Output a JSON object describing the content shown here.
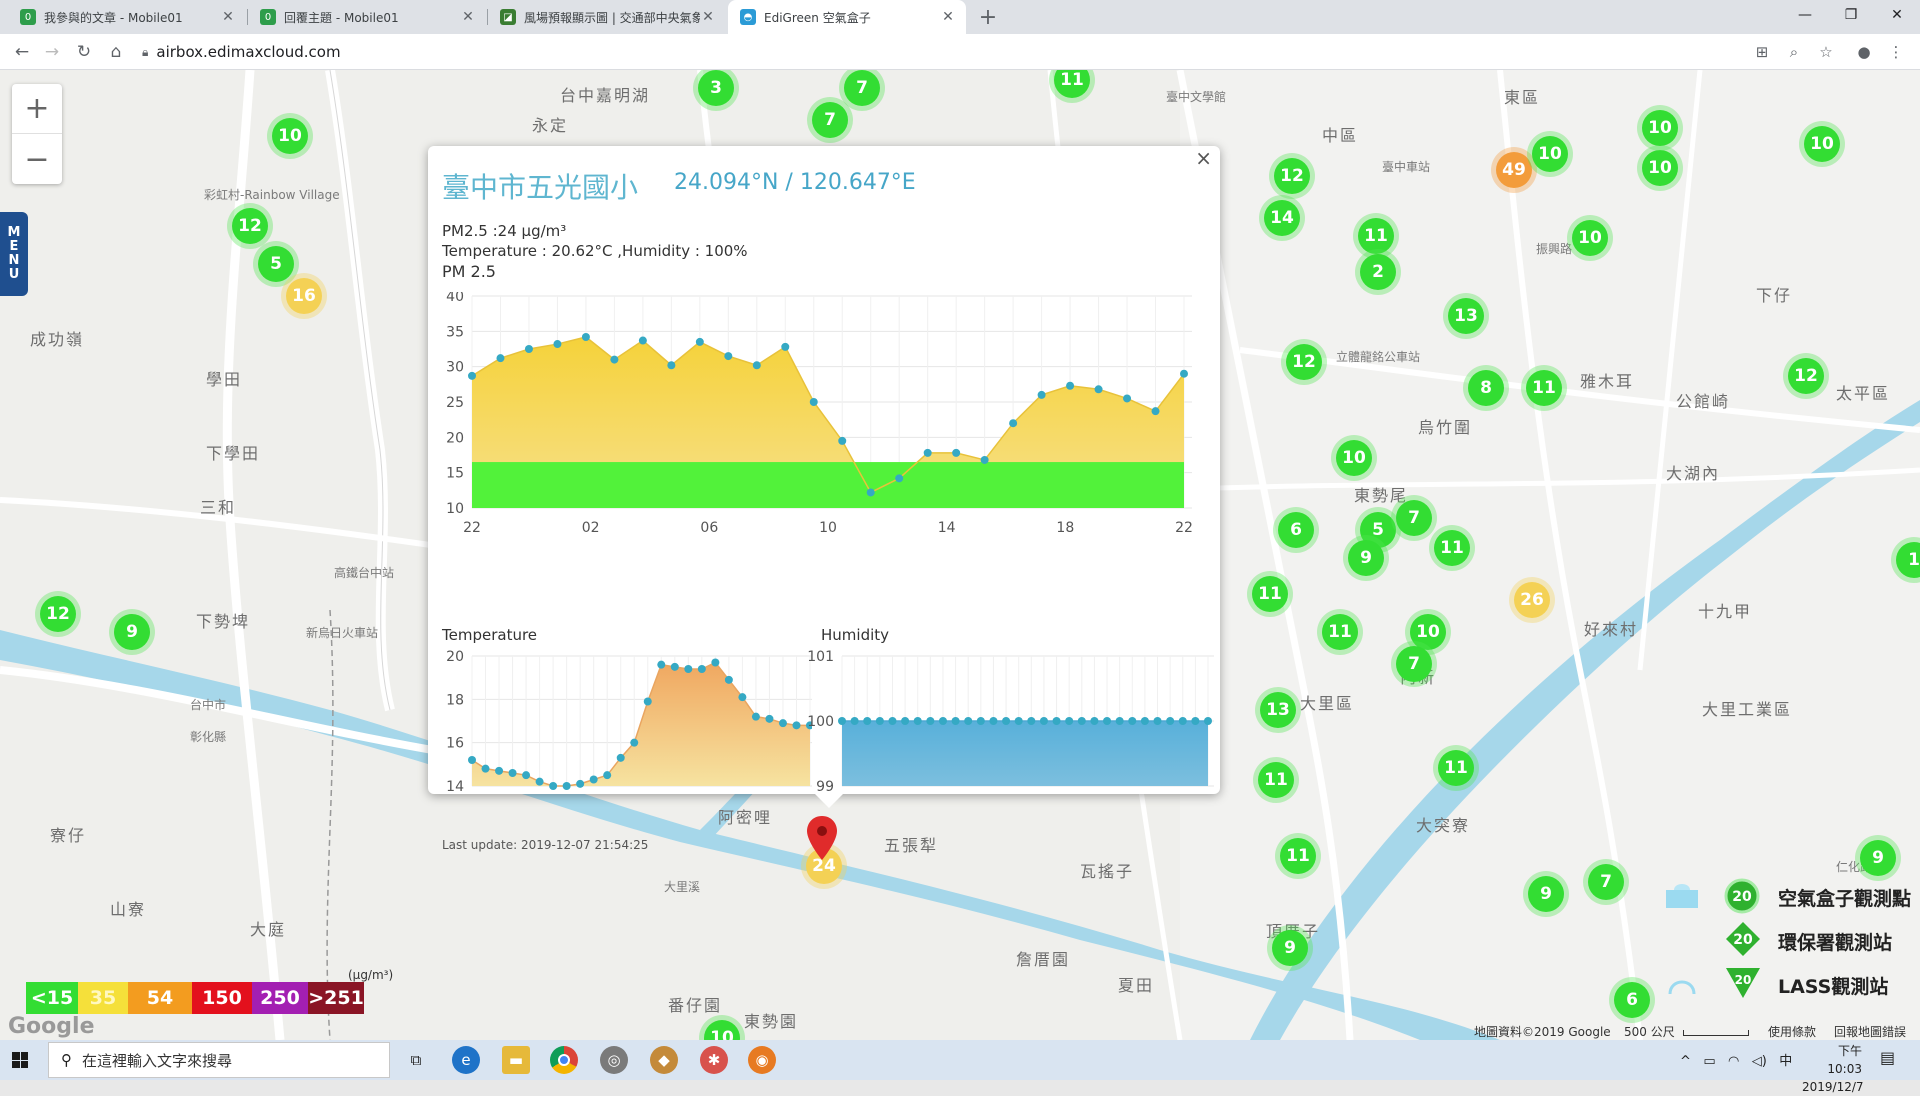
{
  "browser": {
    "tabs": [
      {
        "title": "我參與的文章 - Mobile01",
        "favicon_color": "#2e9d4b"
      },
      {
        "title": "回覆主題 - Mobile01",
        "favicon_color": "#2e9d4b"
      },
      {
        "title": "風場預報顯示圖 | 交通部中央氣象局",
        "favicon_color": "#3a7d32"
      },
      {
        "title": "EdiGreen 空氣盒子",
        "favicon_color": "#2b9bd6"
      }
    ],
    "active_tab": 3,
    "new_tab": "+",
    "url": "airbox.edimaxcloud.com",
    "window_controls": {
      "minimize": "—",
      "maximize": "❐",
      "close": "✕"
    }
  },
  "map": {
    "zoom_in": "+",
    "zoom_out": "−",
    "menu_label": [
      "M",
      "E",
      "N",
      "U"
    ],
    "labels": [
      {
        "text": "台中嘉明湖",
        "small": false
      },
      {
        "text": "永定",
        "small": false
      },
      {
        "text": "臺中文學館",
        "small": true
      },
      {
        "text": "東區",
        "small": false
      },
      {
        "text": "中區",
        "small": false
      },
      {
        "text": "臺中車站",
        "small": true
      },
      {
        "text": "振興路",
        "small": true
      },
      {
        "text": "成功嶺",
        "small": false
      },
      {
        "text": "學田",
        "small": false
      },
      {
        "text": "下學田",
        "small": false
      },
      {
        "text": "三和",
        "small": false
      },
      {
        "text": "高鐵台中站",
        "small": true
      },
      {
        "text": "下勢埤",
        "small": false
      },
      {
        "text": "新烏日火車站",
        "small": true
      },
      {
        "text": "彩虹村-Rainbow Village",
        "small": true
      },
      {
        "text": "雅木耳",
        "small": false
      },
      {
        "text": "公館崎",
        "small": false
      },
      {
        "text": "太平區",
        "small": false
      },
      {
        "text": "大湖內",
        "small": false
      },
      {
        "text": "烏竹圍",
        "small": false
      },
      {
        "text": "東勢尾",
        "small": false
      },
      {
        "text": "十九甲",
        "small": false
      },
      {
        "text": "好來村",
        "small": false
      },
      {
        "text": "大里區",
        "small": false
      },
      {
        "text": "大里工業區",
        "small": false
      },
      {
        "text": "內新",
        "small": false
      },
      {
        "text": "五張犁",
        "small": false
      },
      {
        "text": "阿密哩",
        "small": false
      },
      {
        "text": "瓦搖子",
        "small": false
      },
      {
        "text": "大突寮",
        "small": false
      },
      {
        "text": "頂厝子",
        "small": false
      },
      {
        "text": "詹厝園",
        "small": false
      },
      {
        "text": "夏田",
        "small": false
      },
      {
        "text": "番仔園",
        "small": false
      },
      {
        "text": "東勢園",
        "small": false
      },
      {
        "text": "寮仔",
        "small": false
      },
      {
        "text": "山寮",
        "small": false
      },
      {
        "text": "大庭",
        "small": false
      },
      {
        "text": "立體龍銘公車站",
        "small": true
      },
      {
        "text": "下仔",
        "small": false
      },
      {
        "text": "仁化路",
        "small": true
      },
      {
        "text": "大里溪",
        "small": true
      },
      {
        "text": "台中市",
        "small": true
      },
      {
        "text": "彰化縣",
        "small": true
      }
    ],
    "markers": [
      {
        "v": "3",
        "c": "green"
      },
      {
        "v": "7",
        "c": "green"
      },
      {
        "v": "7",
        "c": "green"
      },
      {
        "v": "11",
        "c": "green"
      },
      {
        "v": "10",
        "c": "green"
      },
      {
        "v": "12",
        "c": "green"
      },
      {
        "v": "5",
        "c": "green"
      },
      {
        "v": "16",
        "c": "yellow"
      },
      {
        "v": "12",
        "c": "green"
      },
      {
        "v": "14",
        "c": "green"
      },
      {
        "v": "49",
        "c": "orange"
      },
      {
        "v": "10",
        "c": "green"
      },
      {
        "v": "10",
        "c": "green"
      },
      {
        "v": "10",
        "c": "green"
      },
      {
        "v": "10",
        "c": "green"
      },
      {
        "v": "10",
        "c": "green"
      },
      {
        "v": "11",
        "c": "green"
      },
      {
        "v": "2",
        "c": "green"
      },
      {
        "v": "13",
        "c": "green"
      },
      {
        "v": "12",
        "c": "green"
      },
      {
        "v": "8",
        "c": "green"
      },
      {
        "v": "11",
        "c": "green"
      },
      {
        "v": "12",
        "c": "green"
      },
      {
        "v": "10",
        "c": "green"
      },
      {
        "v": "6",
        "c": "green"
      },
      {
        "v": "5",
        "c": "green"
      },
      {
        "v": "7",
        "c": "green"
      },
      {
        "v": "9",
        "c": "green"
      },
      {
        "v": "11",
        "c": "green"
      },
      {
        "v": "26",
        "c": "yellow"
      },
      {
        "v": "11",
        "c": "green"
      },
      {
        "v": "11",
        "c": "green"
      },
      {
        "v": "10",
        "c": "green"
      },
      {
        "v": "7",
        "c": "green"
      },
      {
        "v": "13",
        "c": "green"
      },
      {
        "v": "11",
        "c": "green"
      },
      {
        "v": "11",
        "c": "green"
      },
      {
        "v": "11",
        "c": "green"
      },
      {
        "v": "9",
        "c": "green"
      },
      {
        "v": "9",
        "c": "green"
      },
      {
        "v": "7",
        "c": "green"
      },
      {
        "v": "9",
        "c": "green"
      },
      {
        "v": "6",
        "c": "green"
      },
      {
        "v": "12",
        "c": "green"
      },
      {
        "v": "9",
        "c": "green"
      },
      {
        "v": "10",
        "c": "green"
      },
      {
        "v": "24",
        "c": "yellow"
      },
      {
        "v": "1",
        "c": "green"
      }
    ],
    "legend_scale": [
      {
        "label": "<15",
        "color": "#33dd33"
      },
      {
        "label": "35",
        "color": "#f5e03a"
      },
      {
        "label": "54",
        "color": "#f39c1f"
      },
      {
        "label": "150",
        "color": "#e3101d"
      },
      {
        "label": "250",
        "color": "#a31fb2"
      },
      {
        "label": ">251",
        "color": "#8a1525"
      }
    ],
    "legend_unit": "(μg/m³)",
    "google": "Google",
    "copyright": "地圖資料©2019 Google",
    "scale_text": "500 公尺",
    "terms": "使用條款",
    "report": "回報地圖錯誤",
    "station_legend": [
      {
        "label": "空氣盒子觀測點",
        "value": "20",
        "shape": "circle"
      },
      {
        "label": "環保署觀測站",
        "value": "20",
        "shape": "diamond"
      },
      {
        "label": "LASS觀測站",
        "value": "20",
        "shape": "triangle"
      }
    ]
  },
  "popup": {
    "close": "×",
    "title": "臺中市五光國小",
    "coords": "24.094°N / 120.647°E",
    "pm25_text": "PM2.5 :24 μg/m³",
    "temp_hum_text": "Temperature : 20.62°C ,Humidity : 100%",
    "chart_label": "PM 2.5",
    "temp_title": "Temperature",
    "hum_title": "Humidity",
    "last_update": "Last update: 2019-12-07 21:54:25"
  },
  "chart_data": [
    {
      "type": "area",
      "title": "PM 2.5",
      "ylim": [
        10,
        40
      ],
      "yticks": [
        10,
        15,
        20,
        25,
        30,
        35,
        40
      ],
      "xticks": [
        "22",
        "02",
        "06",
        "10",
        "14",
        "18",
        "22"
      ],
      "x": [
        22,
        23,
        0,
        1,
        2,
        3,
        4,
        5,
        6,
        7,
        8,
        9,
        10,
        11,
        12,
        13,
        14,
        15,
        16,
        17,
        18,
        19,
        20,
        21,
        22
      ],
      "values": [
        28.7,
        31.2,
        32.5,
        33.2,
        34.2,
        31,
        33.7,
        30.2,
        33.5,
        31.5,
        30.2,
        32.8,
        25,
        19.5,
        12.2,
        14.2,
        17.8,
        17.8,
        16.8,
        22,
        26,
        27.3,
        26.8,
        25.5,
        23.7,
        29
      ],
      "band_below": 16.5,
      "grid": true
    },
    {
      "type": "area",
      "title": "Temperature",
      "ylim": [
        14,
        20
      ],
      "yticks": [
        14,
        16,
        18,
        20
      ],
      "values": [
        15.2,
        14.8,
        14.7,
        14.6,
        14.5,
        14.2,
        14,
        14,
        14.1,
        14.3,
        14.5,
        15.3,
        16,
        17.9,
        19.6,
        19.5,
        19.4,
        19.4,
        19.7,
        18.9,
        18.1,
        17.2,
        17.1,
        16.9,
        16.8,
        16.8
      ],
      "grid": true
    },
    {
      "type": "area",
      "title": "Humidity",
      "ylim": [
        99,
        101
      ],
      "yticks": [
        99,
        100,
        101
      ],
      "values": [
        100,
        100,
        100,
        100,
        100,
        100,
        100,
        100,
        100,
        100,
        100,
        100,
        100,
        100,
        100,
        100,
        100,
        100,
        100,
        100,
        100,
        100,
        100,
        100,
        100,
        100,
        100,
        100,
        100,
        100
      ],
      "grid": true
    }
  ],
  "taskbar": {
    "search_placeholder": "在這裡輸入文字來搜尋",
    "time": "下午 10:03",
    "date": "2019/12/7",
    "ime": "中"
  }
}
